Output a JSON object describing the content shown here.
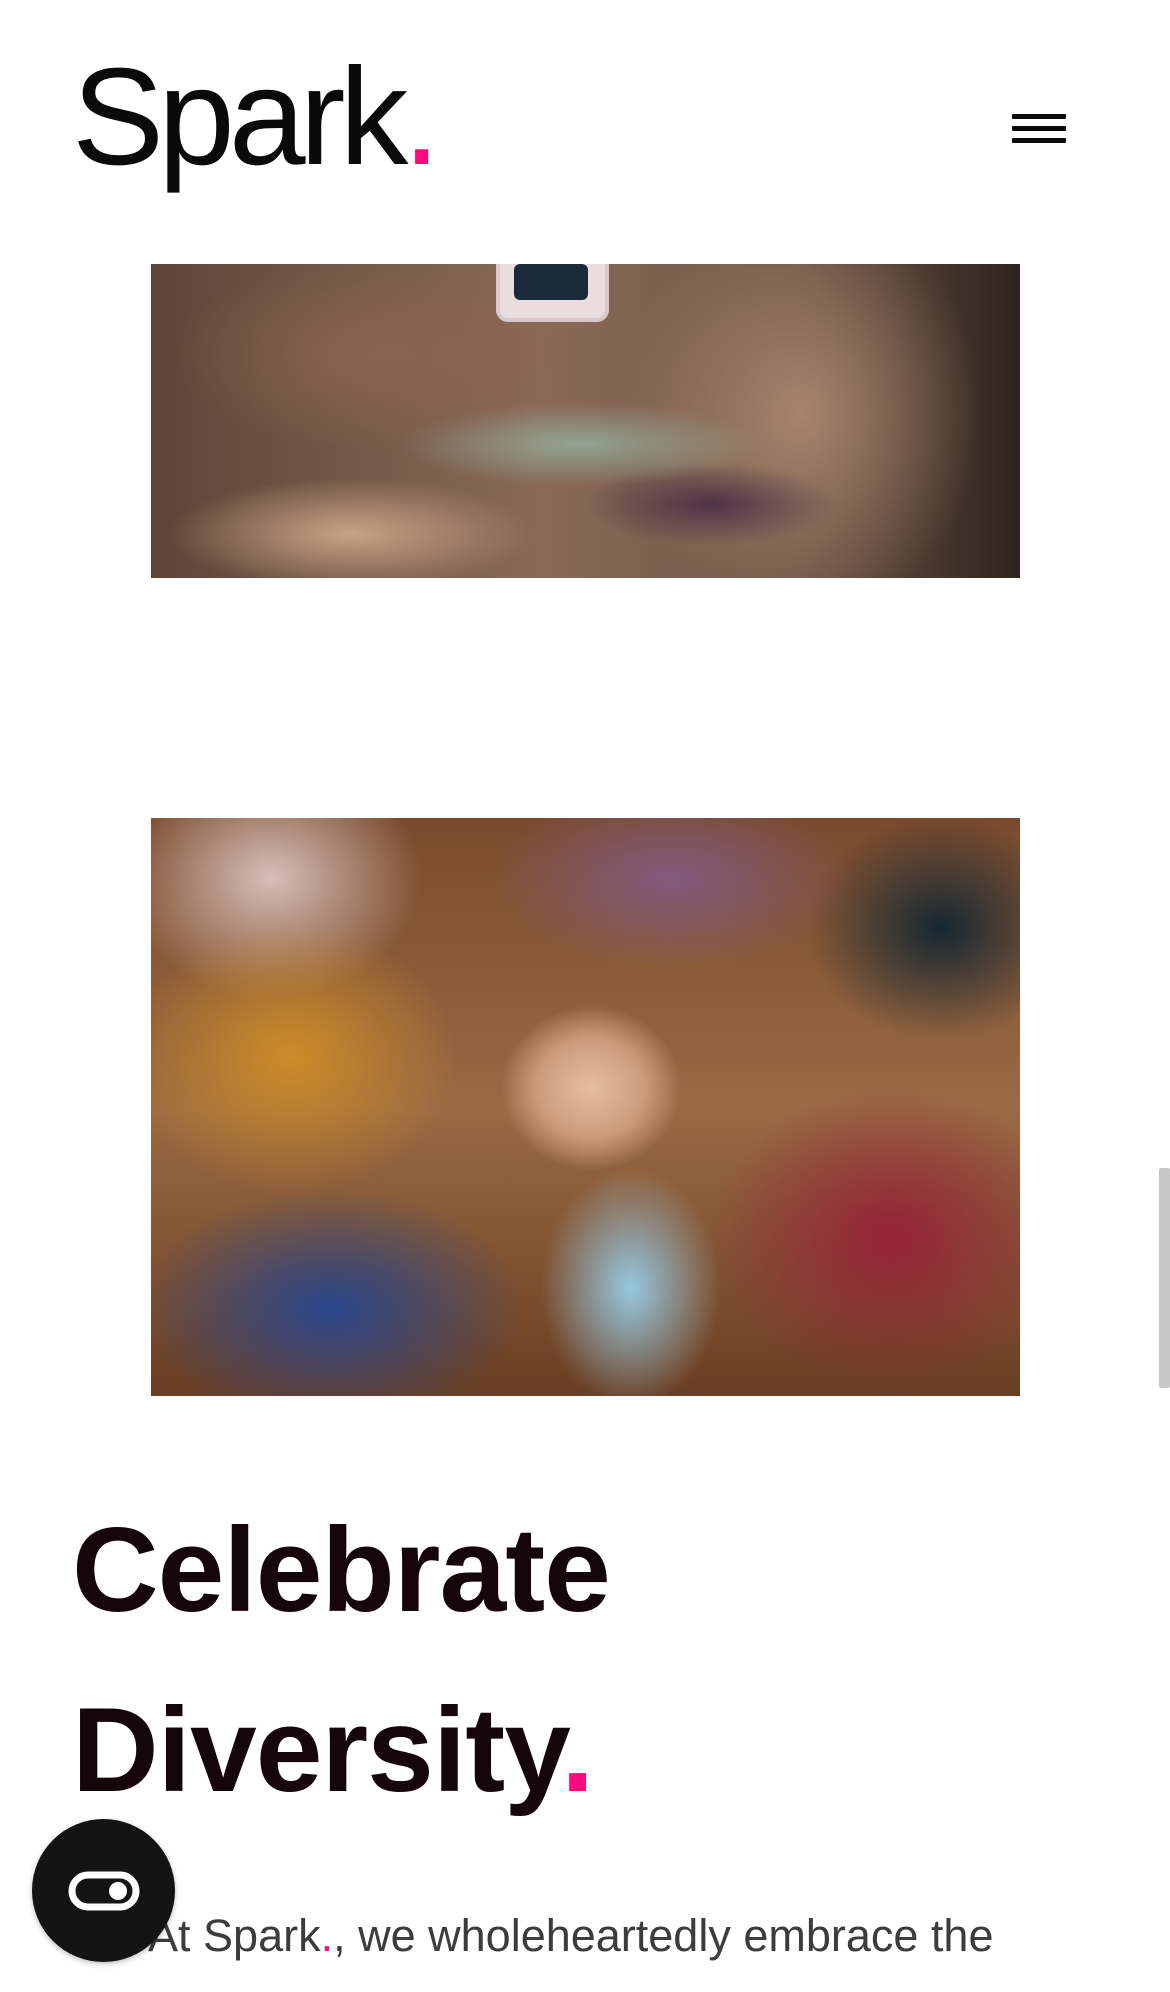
{
  "header": {
    "logo_text": "Spark",
    "logo_dot": ".",
    "menu_icon": "hamburger-menu-icon"
  },
  "images": {
    "first_alt": "Close-up of a wrist wearing a smartwatch",
    "second_alt": "Group of people stacking hands together in a circle"
  },
  "main": {
    "heading_line1": "Celebrate",
    "heading_line2": "Diversity",
    "heading_dot": ".",
    "body_prefix": "At ",
    "body_brand": "Spark",
    "body_brand_dot": ".",
    "body_rest": ", we wholeheartedly embrace the"
  },
  "widgets": {
    "accessibility_icon": "accessibility-toggle-icon"
  },
  "colors": {
    "accent": "#ff0a7a",
    "text": "#14060a",
    "body": "#3c3c3c"
  }
}
